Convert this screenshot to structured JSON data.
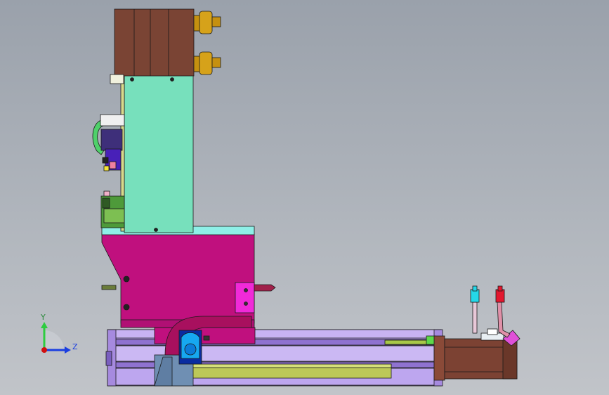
{
  "viewport": {
    "background_top": "#9aa1ab",
    "background_bottom": "#c1c4c9"
  },
  "colors": {
    "outline": "#1a1a1a",
    "cylinder_body": "#7a4434",
    "brass_fitting": "#d6a21a",
    "plate_mint": "#77e0bc",
    "base_cyan": "#8eefe7",
    "housing_magenta": "#c0107e",
    "rail_lavender": "#b69ceb",
    "rail_dark": "#8f72d0",
    "slider_olive": "#bcc858",
    "motor_brown": "#7c4233",
    "valve_navy": "#3e2f7a",
    "hose_green": "#4fd06a",
    "connector_cyan": "#25d7e8",
    "connector_red": "#e3172e",
    "connector_magenta": "#e050d8",
    "bracket_steel": "#6f8fb3"
  },
  "triad": {
    "y_label": "Y",
    "z_label": "Z",
    "y_color": "#2ecc40",
    "z_color": "#1a3ee0",
    "origin_color": "#d01010"
  },
  "icons": {
    "triad": "axis-triad-icon"
  }
}
